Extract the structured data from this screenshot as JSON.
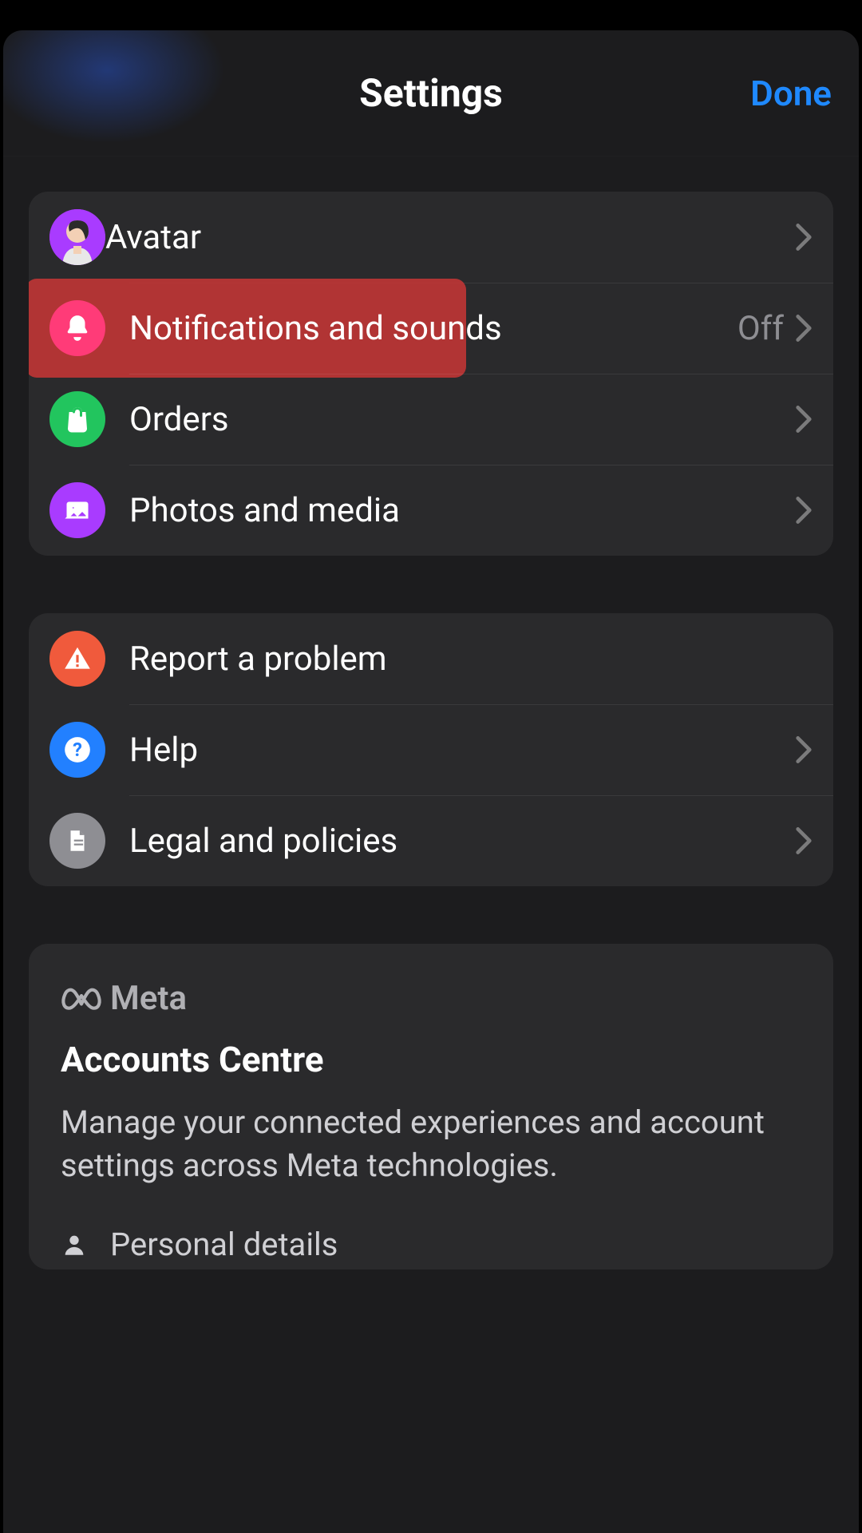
{
  "header": {
    "title": "Settings",
    "done": "Done"
  },
  "group1": {
    "avatar": {
      "label": "Avatar"
    },
    "notifications": {
      "label": "Notifications and sounds",
      "value": "Off"
    },
    "orders": {
      "label": "Orders"
    },
    "photos": {
      "label": "Photos and media"
    }
  },
  "group2": {
    "report": {
      "label": "Report a problem"
    },
    "help": {
      "label": "Help"
    },
    "legal": {
      "label": "Legal and policies"
    }
  },
  "meta": {
    "brand": "Meta",
    "title": "Accounts Centre",
    "desc": "Manage your connected experiences and account settings across Meta technologies.",
    "personal": "Personal details"
  },
  "colors": {
    "accent": "#1f89ff",
    "notif_icon": "#ff3b78",
    "orders_icon": "#22c55e",
    "photos_icon": "#a93bff",
    "report_icon": "#f05a3c",
    "help_icon": "#2280ff",
    "legal_icon": "#8e8e93"
  }
}
